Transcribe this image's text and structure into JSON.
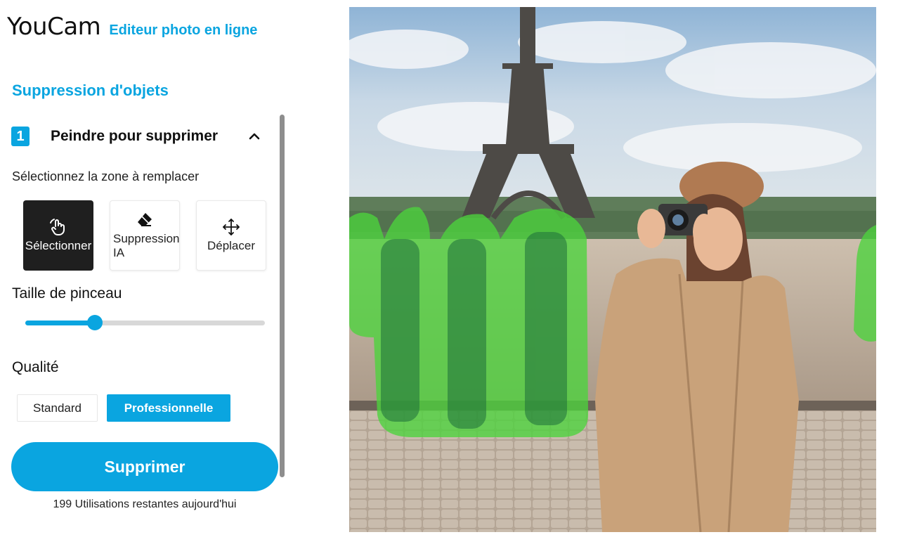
{
  "header": {
    "brand": "YouCam",
    "tagline": "Editeur photo en ligne"
  },
  "panel": {
    "title": "Suppression d'objets",
    "step": {
      "number": "1",
      "label": "Peindre pour supprimer"
    },
    "hint": "Sélectionnez la zone à remplacer",
    "tools": [
      {
        "label": "Sélectionner",
        "icon": "hand-select-icon",
        "active": true
      },
      {
        "label": "Suppression IA",
        "icon": "eraser-icon",
        "active": false
      },
      {
        "label": "Déplacer",
        "icon": "move-arrows-icon",
        "active": false
      }
    ],
    "brush": {
      "label": "Taille de pinceau",
      "value_fraction": 0.29
    },
    "quality": {
      "label": "Qualité",
      "options": [
        "Standard",
        "Professionnelle"
      ],
      "selected": "Professionnelle"
    },
    "delete_button": "Supprimer",
    "usage_text": "199 Utilisations restantes aujourd'hui"
  },
  "colors": {
    "accent": "#0aa5e0",
    "tool_active_bg": "#1f1f1f",
    "mask": "#4cd43c"
  }
}
